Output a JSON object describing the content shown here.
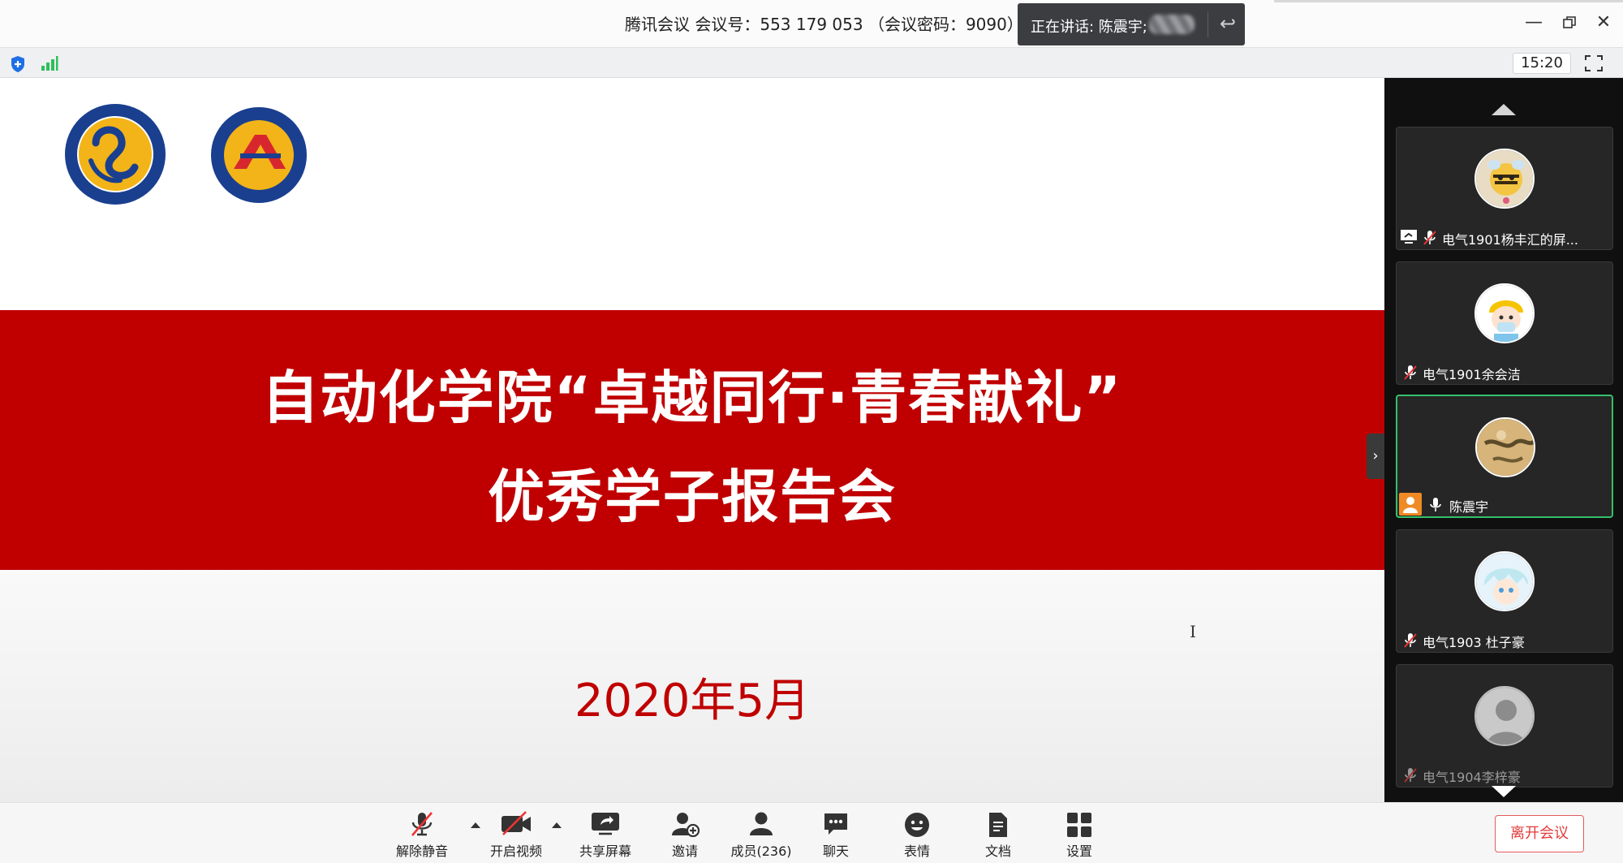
{
  "titlebar": {
    "meeting_title": "腾讯会议 会议号：553 179 053 （会议密码：9090）",
    "speaking_label": "正在讲话: 陈震宇;",
    "minimize_icon": "minimize-icon",
    "restore_icon": "restore-icon",
    "close_icon": "close-icon"
  },
  "statusbar": {
    "clock": "15:20",
    "accent_blue": "#1e6fe6",
    "signal_green": "#2fbf5b"
  },
  "slide": {
    "title": "自动化学院“卓越同行·青春献礼”",
    "subtitle": "优秀学子报告会",
    "date": "2020年5月",
    "banner_color": "#c00000"
  },
  "participants": [
    {
      "name": "电气1901杨丰汇的屏...",
      "sharing": true,
      "muted": true,
      "active": false
    },
    {
      "name": "电气1901余会洁",
      "sharing": false,
      "muted": true,
      "active": false
    },
    {
      "name": "陈震宇",
      "host": true,
      "muted": false,
      "active": true
    },
    {
      "name": "电气1903 杜子豪",
      "sharing": false,
      "muted": true,
      "active": false
    },
    {
      "name": "电气1904李梓豪",
      "sharing": false,
      "muted": true,
      "active": false
    }
  ],
  "toolbar": {
    "unmute_label": "解除静音",
    "video_label": "开启视频",
    "share_label": "共享屏幕",
    "invite_label": "邀请",
    "members_label": "成员(236)",
    "chat_label": "聊天",
    "reactions_label": "表情",
    "docs_label": "文档",
    "settings_label": "设置",
    "leave_label": "离开会议",
    "leave_color": "#e23b3b"
  }
}
